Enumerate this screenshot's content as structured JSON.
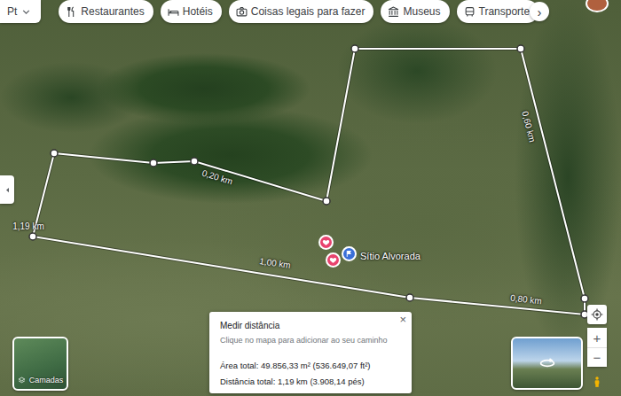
{
  "top_left_chip": "Pt",
  "categories": [
    {
      "label": "Restaurantes"
    },
    {
      "label": "Hotéis"
    },
    {
      "label": "Coisas legais para fazer"
    },
    {
      "label": "Museus"
    },
    {
      "label": "Transporte"
    }
  ],
  "categories_next": "›",
  "map": {
    "segments": [
      {
        "label": "0,20 km"
      },
      {
        "label": "1,19 km"
      },
      {
        "label": "1,00 km"
      },
      {
        "label": "0,80 km"
      },
      {
        "label": "0,60 km"
      }
    ],
    "place": {
      "name": "Sítio Alvorada"
    },
    "saved_pins": [
      {
        "color": "#e8436e"
      },
      {
        "color": "#e8436e"
      }
    ]
  },
  "measure_panel": {
    "title": "Medir distância",
    "hint": "Clique no mapa para adicionar ao seu caminho",
    "area": "Área total: 49.856,33 m² (536.649,07 ft²)",
    "distance": "Distância total: 1,19 km (3.908,14 pés)",
    "close": "×"
  },
  "layers": {
    "label": "Camadas"
  },
  "zoom": {
    "in": "+",
    "out": "−"
  }
}
